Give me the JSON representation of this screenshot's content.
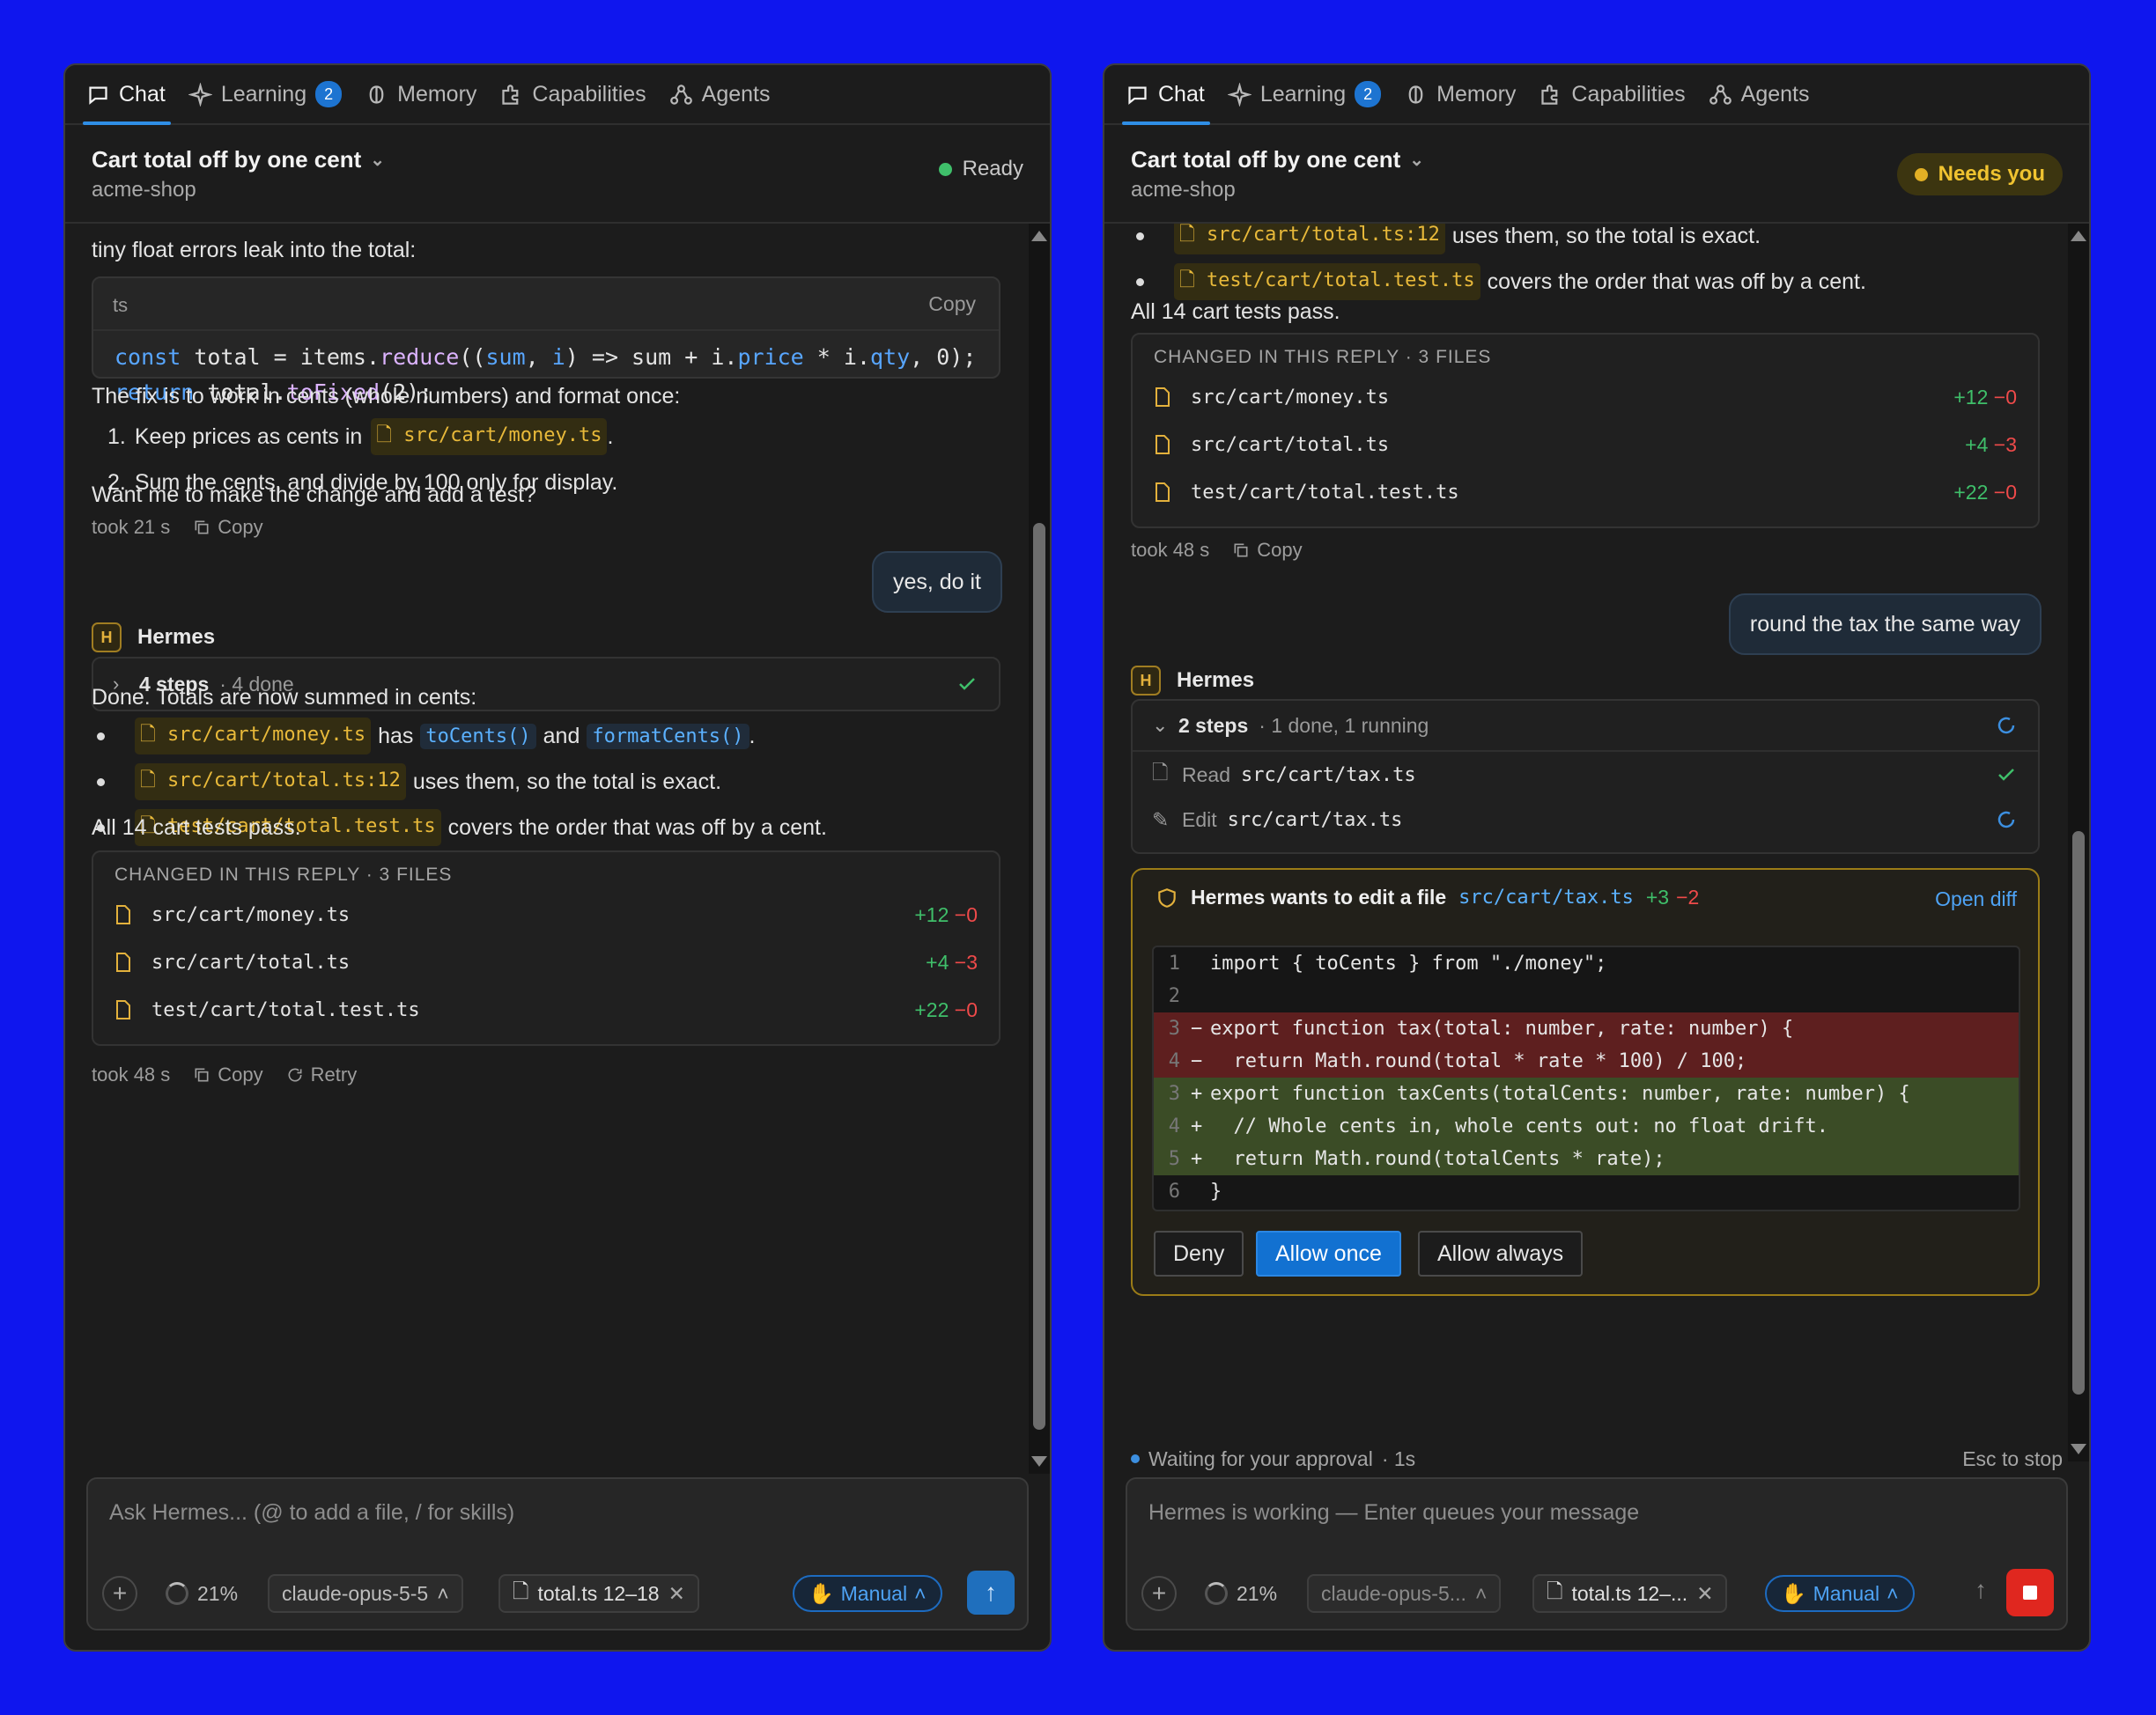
{
  "tabs": [
    {
      "label": "Chat"
    },
    {
      "label": "Learning",
      "badge": "2"
    },
    {
      "label": "Memory"
    },
    {
      "label": "Capabilities"
    },
    {
      "label": "Agents"
    }
  ],
  "header": {
    "title": "Cart total off by one cent",
    "subtitle": "acme-shop"
  },
  "left": {
    "status": "Ready",
    "intro": "tiny float errors leak into the total:",
    "code": {
      "lang": "ts",
      "copy": "Copy",
      "line1_kw": "const",
      "line1_a": " total = items.",
      "line1_fn": "reduce",
      "line1_b": "((",
      "line1_p1": "sum",
      "line1_c": ", ",
      "line1_p2": "i",
      "line1_d": ") => sum + i.",
      "line1_p3": "price",
      "line1_e": " * i.",
      "line1_p4": "qty",
      "line1_f": ", 0);",
      "line2_kw": "return",
      "line2_a": " total.",
      "line2_fn": "toFixed",
      "line2_b": "(2);"
    },
    "fix": "The fix is to work in cents (whole numbers) and format once:",
    "step1_num": "1.",
    "step1_text": "Keep prices as cents in",
    "step1_chip": "src/cart/money.ts",
    "step1_dot": ".",
    "step2_num": "2.",
    "step2_text": "Sum the cents, and divide by 100 only for display.",
    "question": "Want me to make the change and add a test?",
    "meta1_took": "took 21 s",
    "meta1_copy": "Copy",
    "user_msg": "yes, do it",
    "agent": "Hermes",
    "steps_label": "4 steps",
    "steps_detail": "· 4 done",
    "done": "Done. Totals are now summed in cents:",
    "b1_chip": "src/cart/money.ts",
    "b1_t1": "has",
    "b1_c1": "toCents()",
    "b1_t2": "and",
    "b1_c2": "formatCents()",
    "b1_t3": ".",
    "b2_chip": "src/cart/total.ts:12",
    "b2_t": "uses them, so the total is exact.",
    "b3_chip": "test/cart/total.test.ts",
    "b3_t": "covers the order that was off by a cent.",
    "pass": "All 14 cart tests pass.",
    "meta2_took": "took 48 s",
    "meta2_copy": "Copy",
    "meta2_retry": "Retry"
  },
  "changed": {
    "header": "CHANGED IN THIS REPLY · 3 FILES",
    "files": [
      {
        "name": "src/cart/money.ts",
        "add": "+12",
        "del": "−0"
      },
      {
        "name": "src/cart/total.ts",
        "add": "+4",
        "del": "−3"
      },
      {
        "name": "test/cart/total.test.ts",
        "add": "+22",
        "del": "−0"
      }
    ]
  },
  "right": {
    "status": "Needs you",
    "b2_chip": "src/cart/total.ts:12",
    "b2_t": "uses them, so the total is exact.",
    "b3_chip": "test/cart/total.test.ts",
    "b3_t": "covers the order that was off by a cent.",
    "pass": "All 14 cart tests pass.",
    "meta_took": "took 48 s",
    "meta_copy": "Copy",
    "user_msg": "round the tax the same way",
    "agent": "Hermes",
    "steps_label": "2 steps",
    "steps_detail": "· 1 done, 1 running",
    "step1_verb": "Read",
    "step1_file": "src/cart/tax.ts",
    "step2_verb": "Edit",
    "step2_file": "src/cart/tax.ts",
    "approval": {
      "title": "Hermes wants to edit a file",
      "file": "src/cart/tax.ts",
      "add": "+3",
      "del": "−2",
      "open": "Open diff",
      "lines": [
        {
          "n": "1",
          "m": " ",
          "t": "import { toCents } from \"./money\";",
          "k": ""
        },
        {
          "n": "2",
          "m": " ",
          "t": "",
          "k": ""
        },
        {
          "n": "3",
          "m": "−",
          "t": "export function tax(total: number, rate: number) {",
          "k": "r"
        },
        {
          "n": "4",
          "m": "−",
          "t": "  return Math.round(total * rate * 100) / 100;",
          "k": "r"
        },
        {
          "n": "3",
          "m": "+",
          "t": "export function taxCents(totalCents: number, rate: number) {",
          "k": "g"
        },
        {
          "n": "4",
          "m": "+",
          "t": "  // Whole cents in, whole cents out: no float drift.",
          "k": "g"
        },
        {
          "n": "5",
          "m": "+",
          "t": "  return Math.round(totalCents * rate);",
          "k": "g"
        },
        {
          "n": "6",
          "m": " ",
          "t": "}",
          "k": ""
        }
      ],
      "deny": "Deny",
      "allow_once": "Allow once",
      "allow_always": "Allow always"
    },
    "waiting": "Waiting for your approval",
    "waiting_time": "· 1s",
    "esc": "Esc to stop"
  },
  "composer_left": {
    "placeholder": "Ask Hermes... (@ to add a file, / for skills)",
    "context": "21%",
    "model": "claude-opus-5-5",
    "file": "total.ts 12–18",
    "mode": "Manual"
  },
  "composer_right": {
    "placeholder": "Hermes is working — Enter queues your message",
    "context": "21%",
    "model": "claude-opus-5...",
    "file": "total.ts 12–...",
    "mode": "Manual"
  }
}
